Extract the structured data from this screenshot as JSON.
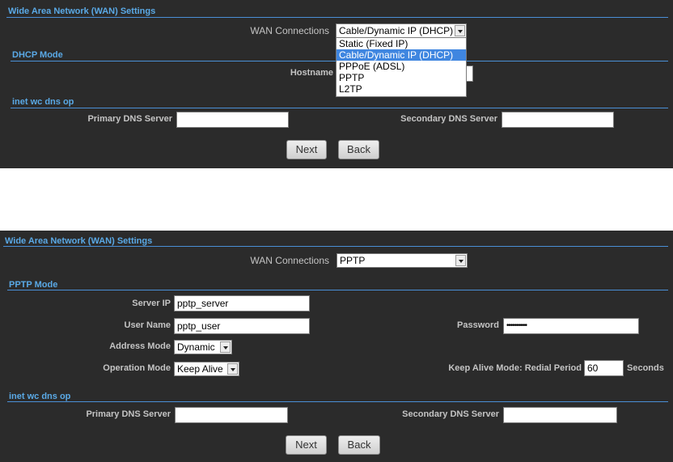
{
  "panel1": {
    "title": "Wide Area Network (WAN) Settings",
    "wan_label": "WAN Connections",
    "wan_value": "Cable/Dynamic IP (DHCP)",
    "wan_options": [
      "Static (Fixed IP)",
      "Cable/Dynamic IP (DHCP)",
      "PPPoE (ADSL)",
      "PPTP",
      "L2TP"
    ],
    "dhcp_title": "DHCP Mode",
    "hostname_label": "Hostname",
    "hostname_value": "",
    "dns_title": "inet wc dns op",
    "primary_dns_label": "Primary DNS Server",
    "primary_dns_value": "",
    "secondary_dns_label": "Secondary DNS Server",
    "secondary_dns_value": "",
    "next_label": "Next",
    "back_label": "Back"
  },
  "panel2": {
    "title": "Wide Area Network (WAN) Settings",
    "wan_label": "WAN Connections",
    "wan_value": "PPTP",
    "pptp_title": "PPTP Mode",
    "server_ip_label": "Server IP",
    "server_ip_value": "pptp_server",
    "username_label": "User Name",
    "username_value": "pptp_user",
    "password_label": "Password",
    "password_value": "••••••••••",
    "address_mode_label": "Address Mode",
    "address_mode_value": "Dynamic",
    "operation_mode_label": "Operation Mode",
    "operation_mode_value": "Keep Alive",
    "keepalive_label": "Keep Alive Mode: Redial Period",
    "keepalive_value": "60",
    "keepalive_unit": "Seconds",
    "dns_title": "inet wc dns op",
    "primary_dns_label": "Primary DNS Server",
    "primary_dns_value": "",
    "secondary_dns_label": "Secondary DNS Server",
    "secondary_dns_value": "",
    "next_label": "Next",
    "back_label": "Back"
  },
  "colors": {
    "panel_bg": "#2b2b2b",
    "title": "#5aa9e6",
    "rule": "#4a8fd6",
    "label": "#c4c4c4",
    "selected_option": "#3f86e0"
  }
}
